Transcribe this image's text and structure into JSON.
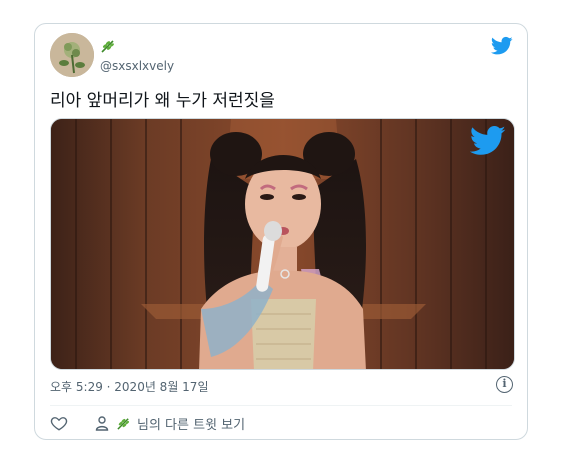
{
  "tweet": {
    "handle": "@sxsxlxvely",
    "name_emoji": "herb-icon",
    "text": "리아 앞머리가 왜 누가 저런짓을",
    "timestamp": "오후 5:29 · 2020년 8월 17일",
    "more_tweets_label": "님의 다른 트윗 보기"
  },
  "icons": {
    "brand": "twitter-bird-icon",
    "info": "info-icon",
    "like": "heart-icon",
    "profile": "person-icon"
  },
  "colors": {
    "twitter_blue": "#1d9bf0",
    "secondary_text": "#536471",
    "border": "#cfd9de"
  }
}
